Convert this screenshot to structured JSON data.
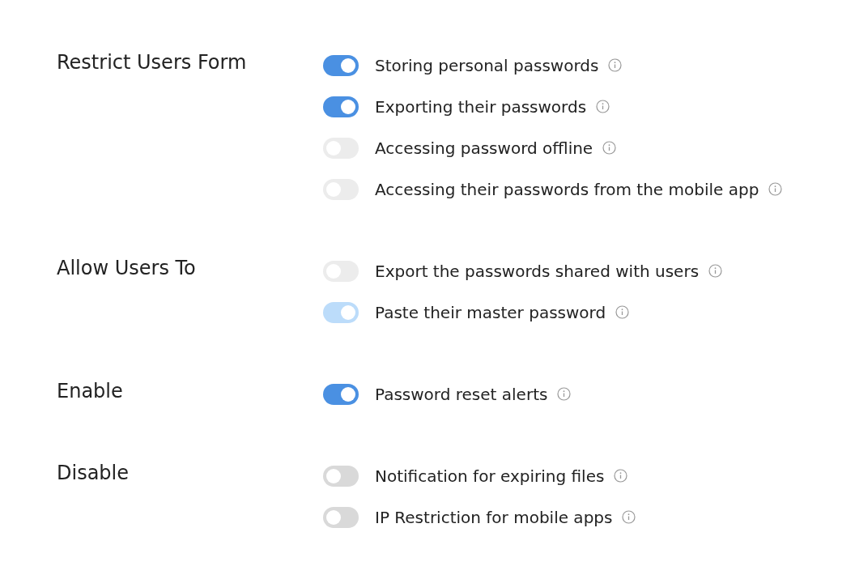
{
  "sections": [
    {
      "title": "Restrict Users Form",
      "options": [
        {
          "label": "Storing personal passwords",
          "on": true,
          "disabled": false
        },
        {
          "label": "Exporting their passwords",
          "on": true,
          "disabled": false
        },
        {
          "label": "Accessing password offline",
          "on": false,
          "disabled": true
        },
        {
          "label": "Accessing their passwords from the mobile app",
          "on": false,
          "disabled": true
        }
      ]
    },
    {
      "title": "Allow Users To",
      "options": [
        {
          "label": "Export the passwords shared with users",
          "on": false,
          "disabled": true
        },
        {
          "label": "Paste their master password",
          "on": true,
          "disabled": true
        }
      ]
    },
    {
      "title": "Enable",
      "options": [
        {
          "label": "Password reset alerts",
          "on": true,
          "disabled": false
        }
      ]
    },
    {
      "title": "Disable",
      "options": [
        {
          "label": "Notification for expiring files",
          "on": false,
          "disabled": false
        },
        {
          "label": "IP Restriction for mobile apps",
          "on": false,
          "disabled": false
        }
      ]
    }
  ]
}
